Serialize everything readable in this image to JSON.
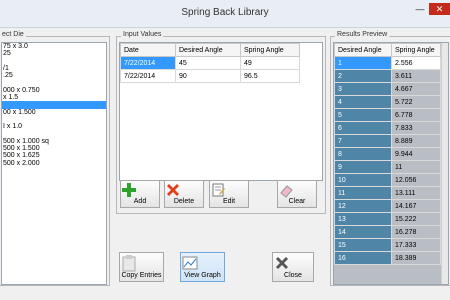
{
  "window": {
    "title": "Spring Back Library",
    "minimize": "—",
    "close": "✕"
  },
  "select_die": {
    "label": "ect Die",
    "items": [
      "75 x 3.0",
      "25",
      "",
      "/1",
      ".25",
      "",
      "000 x 0.750",
      "x 1.5",
      "",
      "00 x 1.500",
      "",
      "I x 1.0",
      "",
      "500 x 1.000 sq",
      "500 x 1.500",
      "500 x 1.625",
      "500 x 2.000"
    ],
    "selected_index": 8
  },
  "input_values": {
    "label": "Input Values",
    "columns": [
      "Date",
      "Desired Angle",
      "Spring Angle"
    ],
    "rows": [
      {
        "date": "7/22/2014",
        "desired": "45",
        "spring": "49"
      },
      {
        "date": "7/22/2014",
        "desired": "90",
        "spring": "96.5"
      }
    ]
  },
  "buttons": {
    "add": "Add",
    "delete": "Delete",
    "edit": "Edit",
    "clear": "Clear",
    "copy": "Copy Entries",
    "view": "View Graph",
    "close": "Close"
  },
  "results": {
    "label": "Results Preview",
    "columns": [
      "Desired Angle",
      "Spring Angle"
    ],
    "rows": [
      {
        "i": "1",
        "v": "2.556"
      },
      {
        "i": "2",
        "v": "3.611"
      },
      {
        "i": "3",
        "v": "4.667"
      },
      {
        "i": "4",
        "v": "5.722"
      },
      {
        "i": "5",
        "v": "6.778"
      },
      {
        "i": "6",
        "v": "7.833"
      },
      {
        "i": "7",
        "v": "8.889"
      },
      {
        "i": "8",
        "v": "9.944"
      },
      {
        "i": "9",
        "v": "11"
      },
      {
        "i": "10",
        "v": "12.056"
      },
      {
        "i": "11",
        "v": "13.111"
      },
      {
        "i": "12",
        "v": "14.167"
      },
      {
        "i": "13",
        "v": "15.222"
      },
      {
        "i": "14",
        "v": "16.278"
      },
      {
        "i": "15",
        "v": "17.333"
      },
      {
        "i": "16",
        "v": "18.389"
      }
    ]
  },
  "colors": {
    "accent": "#3399ff",
    "title_bar": "#e9eef5",
    "close_red": "#c42b1c"
  }
}
